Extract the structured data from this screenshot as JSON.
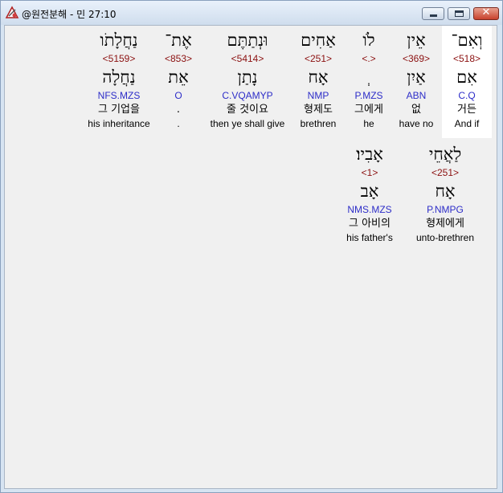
{
  "window": {
    "title": "@원전분해 - 민 27:10"
  },
  "icons": {
    "app": "app-icon",
    "minimize": "minimize-icon",
    "maximize": "maximize-icon",
    "close": "close-icon"
  },
  "colors": {
    "strong": "#8b1010",
    "morph": "#2d2dc8",
    "highlight": "#ffffff"
  },
  "words": [
    {
      "hebrew": "וְאִם־",
      "strong": "<518>",
      "lemma": "אִם",
      "morph": "C.Q",
      "korean": "거든",
      "english": "And if"
    },
    {
      "hebrew": "אֵין",
      "strong": "<369>",
      "lemma": "אַיִן",
      "morph": "ABN",
      "korean": "없",
      "english": "have no"
    },
    {
      "hebrew": "לֹו",
      "strong": "<.>",
      "lemma": "ְ",
      "morph": "P.MZS",
      "korean": "그에게",
      "english": "he"
    },
    {
      "hebrew": "אַחִים",
      "strong": "<251>",
      "lemma": "אָח",
      "morph": "NMP",
      "korean": "형제도",
      "english": "brethren"
    },
    {
      "hebrew": "וּנְתַתֶּם",
      "strong": "<5414>",
      "lemma": "נָתַן",
      "morph": "C.VQAMYP",
      "korean": "줄 것이요",
      "english": "then ye shall give"
    },
    {
      "hebrew": "אֶת־",
      "strong": "<853>",
      "lemma": "אֵת",
      "morph": "O",
      "korean": ".",
      "english": "."
    },
    {
      "hebrew": "נַחֲלָתֹו",
      "strong": "<5159>",
      "lemma": "נַחֲלָה",
      "morph": "NFS.MZS",
      "korean": "그 기업을",
      "english": "his inheritance"
    },
    {
      "hebrew": "לַאֲחֵי",
      "strong": "<251>",
      "lemma": "אָח",
      "morph": "P.NMPG",
      "korean": "형제에게",
      "english": "unto-brethren"
    },
    {
      "hebrew": "אָבִיו׃",
      "strong": "<1>",
      "lemma": "אָב",
      "morph": "NMS.MZS",
      "korean": "그 아비의",
      "english": "his father's"
    }
  ]
}
